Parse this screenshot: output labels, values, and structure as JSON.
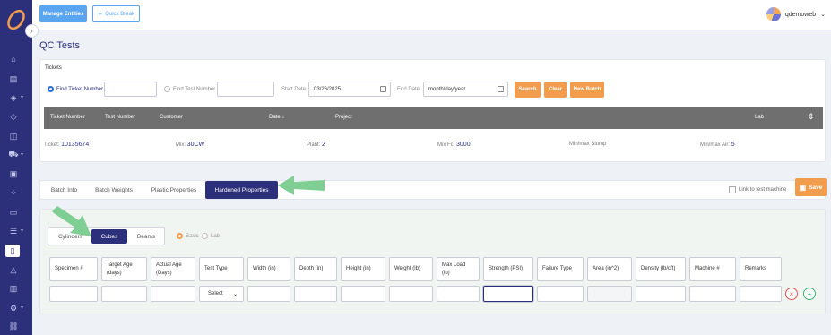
{
  "header": {
    "manage_entities": "Manage Entities",
    "quick_break": "Quick Break",
    "username": "qdemoweb"
  },
  "page": {
    "title": "QC Tests"
  },
  "tickets": {
    "section_label": "Tickets",
    "find_ticket_label": "Find Ticket Number",
    "find_test_label": "Find Test Number",
    "start_date_label": "Start Date",
    "start_date_value": "03/26/2025",
    "end_date_label": "End Date",
    "end_date_placeholder": "month/day/year",
    "search": "Search",
    "clear": "Clear",
    "new_batch": "New Batch",
    "columns": [
      "Ticket Number",
      "Test Number",
      "Customer",
      "Date ↓",
      "Project",
      "Lab"
    ],
    "row": {
      "ticket_label": "Ticket:",
      "ticket_value": "10135674",
      "mix_label": "Mix:",
      "mix_value": "30CW",
      "plant_label": "Plant:",
      "plant_value": "2",
      "mixfc_label": "Mix Fc:",
      "mixfc_value": "3000",
      "slump_label": "Min/max Slump",
      "air_label": "Min/max Air:",
      "air_value": "5"
    }
  },
  "tabs": {
    "items": [
      "Batch Info",
      "Batch Weights",
      "Plastic Properties",
      "Hardened Properties"
    ],
    "active": "Hardened Properties",
    "link_to_machine": "Link to test machine",
    "save": "Save"
  },
  "properties": {
    "types": [
      "Cylinders",
      "Cubes",
      "Beams"
    ],
    "active_type": "Cubes",
    "modes": [
      "Basic",
      "Lab"
    ],
    "active_mode": "Basic",
    "columns": [
      "Specimen #",
      "Target Age (days)",
      "Actual Age (Days)",
      "Test Type",
      "Width (in)",
      "Depth (in)",
      "Height (in)",
      "Weight (lb)",
      "Max Load (lb)",
      "Strength (PSI)",
      "Failure Type",
      "Area (in^2)",
      "Density (lb/cft)",
      "Machine #",
      "Remarks"
    ],
    "select_placeholder": "Select"
  },
  "colors": {
    "sidebar": "#2c2f7a",
    "accent_orange": "#f29d4e",
    "accent_blue": "#5aa5f0",
    "highlight_arrow": "#7fcf95"
  }
}
